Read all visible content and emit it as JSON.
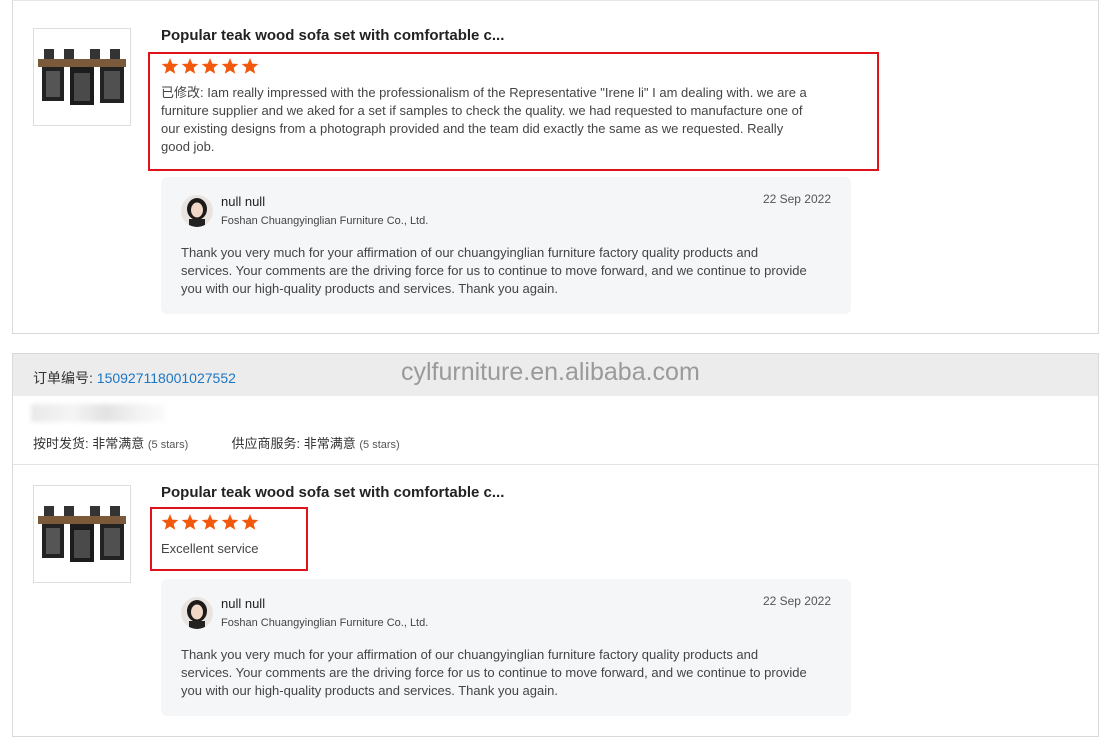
{
  "reviews": [
    {
      "product_title": "Popular teak wood sofa set with comfortable c...",
      "rating": 5,
      "review_text": "已修改: Iam really impressed with the professionalism of the Representative \"Irene li\" I am dealing with. we are a furniture supplier and we aked for a set if samples to check the quality. we had requested to manufacture one of our existing designs from a photograph provided and the team did exactly the same as we requested. Really good job.",
      "reply": {
        "name": "null null",
        "company": "Foshan Chuangyinglian Furniture Co., Ltd.",
        "date": "22 Sep 2022",
        "text": "Thank you very much for your affirmation of our chuangyinglian furniture factory quality products and services. Your comments are the driving force for us to continue to move forward, and we continue to provide you with our high-quality products and services. Thank you again."
      }
    },
    {
      "order_label": "订单编号:",
      "order_number": "150927118001027552",
      "ratings": {
        "on_time_label": "按时发货:",
        "on_time_value": "非常满意",
        "on_time_stars": "(5 stars)",
        "service_label": "供应商服务:",
        "service_value": "非常满意",
        "service_stars": "(5 stars)"
      },
      "product_title": "Popular teak wood sofa set with comfortable c...",
      "rating": 5,
      "review_text": "Excellent service",
      "reply": {
        "name": "null null",
        "company": "Foshan Chuangyinglian Furniture Co., Ltd.",
        "date": "22 Sep 2022",
        "text": "Thank you very much for your affirmation of our chuangyinglian furniture factory quality products and services. Your comments are the driving force for us to continue to move forward, and we continue to provide you with our high-quality products and services. Thank you again."
      }
    }
  ],
  "watermark": "cylfurniture.en.alibaba.com",
  "colors": {
    "star": "#f2590d",
    "highlight_box": "#e0131a",
    "link": "#1b76c4"
  }
}
